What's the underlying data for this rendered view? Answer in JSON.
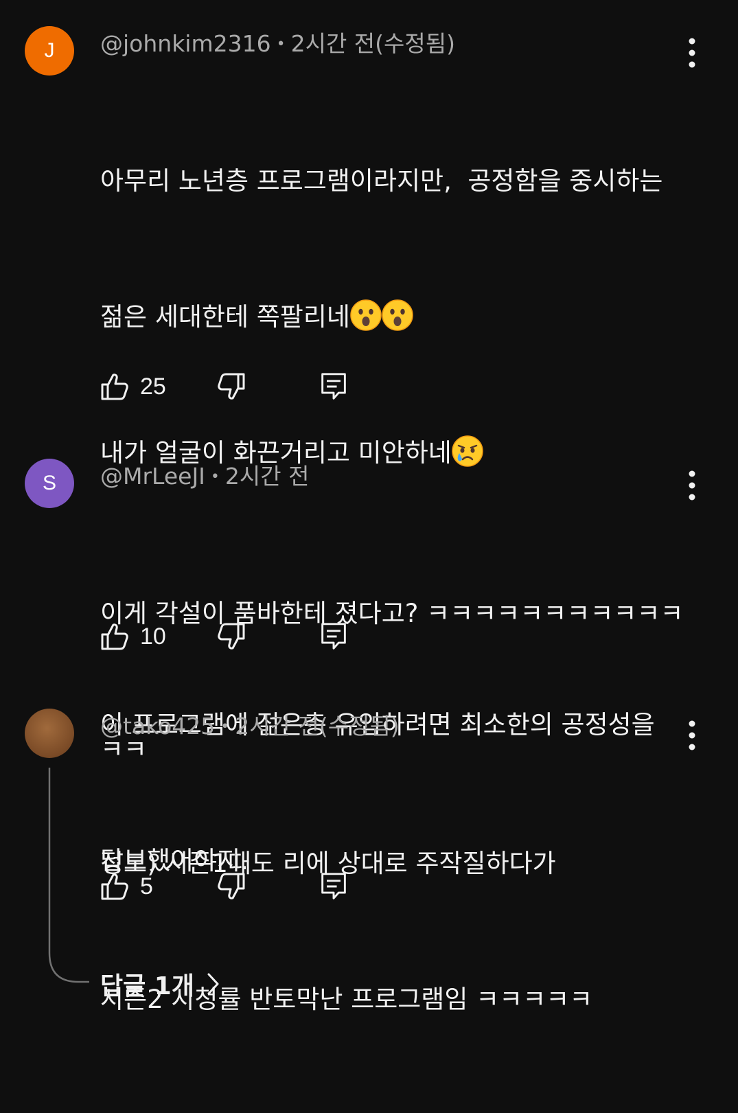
{
  "comments": [
    {
      "avatar_letter": "J",
      "avatar_color": "#ef6c00",
      "author": "@johnkim2316",
      "time": "2시간 전(수정됨)",
      "text_lines": [
        "아무리 노년층 프로그램이라지만,  공정함을 중시하는",
        "젊은 세대한테 쪽팔리네",
        "내가 얼굴이 화끈거리고 미안하네",
        "",
        "이 프로그램에 젊은층 유입하려면 최소한의 공정성을",
        "답보했어야지."
      ],
      "emojis": {
        "line2": "astonished-emoji astonished-emoji",
        "line3": "crying-emoji"
      },
      "likes": "25"
    },
    {
      "avatar_letter": "S",
      "avatar_color": "#7e57c2",
      "author": "@MrLeeJI",
      "time": "2시간 전",
      "text_lines": [
        "이게 각설이 품바한테 졌다고? ㅋㅋㅋㅋㅋㅋㅋㅋㅋㅋㅋ",
        "ㅋㅋ"
      ],
      "likes": "10"
    },
    {
      "avatar_letter": "",
      "avatar_color": "#8a5a34",
      "author": "@tako425",
      "time": "2시간 전(수정됨)",
      "text_lines": [
        "정보) 시즌1때도 리에 상대로 주작질하다가",
        "시즌2 시청률 반토막난 프로그램임 ㅋㅋㅋㅋㅋ"
      ],
      "likes": "5",
      "replies_label": "답글 1개"
    }
  ],
  "icons": {
    "like": "thumb-up-outline-icon",
    "dislike": "thumb-down-outline-icon",
    "reply": "comment-reply-icon",
    "more": "vertical-ellipsis-icon",
    "chevron": "chevron-right-icon"
  },
  "colors": {
    "background": "#0f0f0f",
    "text_primary": "#f1f1f1",
    "text_secondary": "#aaaaaa"
  }
}
